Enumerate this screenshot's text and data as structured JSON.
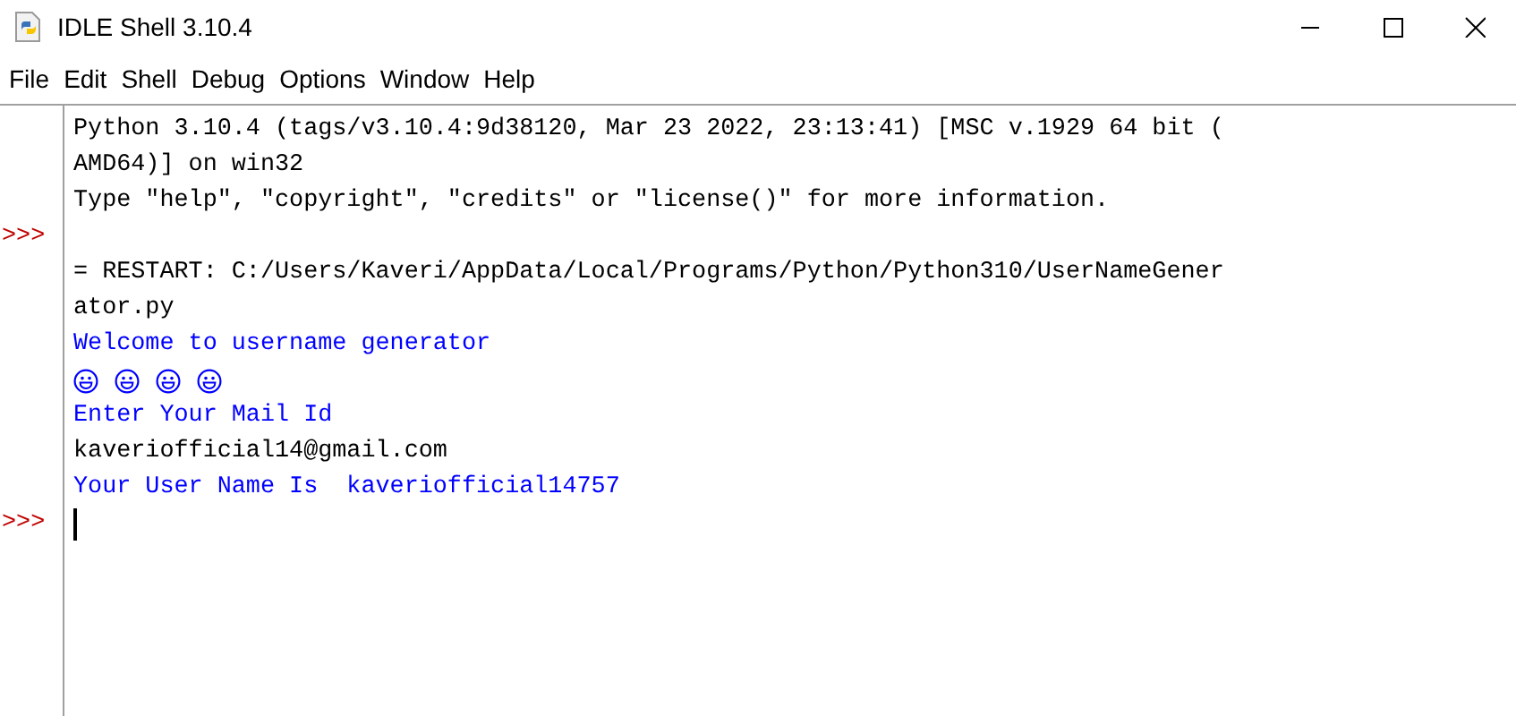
{
  "window": {
    "title": "IDLE Shell 3.10.4"
  },
  "menu": [
    "File",
    "Edit",
    "Shell",
    "Debug",
    "Options",
    "Window",
    "Help"
  ],
  "shell": {
    "lines": [
      {
        "kind": "output",
        "text": "Python 3.10.4 (tags/v3.10.4:9d38120, Mar 23 2022, 23:13:41) [MSC v.1929 64 bit ("
      },
      {
        "kind": "output",
        "text": "AMD64)] on win32"
      },
      {
        "kind": "output",
        "text": "Type \"help\", \"copyright\", \"credits\" or \"license()\" for more information."
      },
      {
        "kind": "blank",
        "prompt": ">>>"
      },
      {
        "kind": "output",
        "text": "= RESTART: C:/Users/Kaveri/AppData/Local/Programs/Python/Python310/UserNameGener"
      },
      {
        "kind": "output",
        "text": "ator.py"
      },
      {
        "kind": "stdout",
        "text": "Welcome to username generator"
      },
      {
        "kind": "icons",
        "icons": [
          {
            "kind": "smiley"
          },
          {
            "kind": "smiley"
          },
          {
            "kind": "smiley"
          },
          {
            "kind": "smiley"
          }
        ]
      },
      {
        "kind": "stdout",
        "text": "Enter Your Mail Id"
      },
      {
        "kind": "input",
        "text": "kaveriofficial14@gmail.com"
      },
      {
        "kind": "stdout",
        "text": "Your User Name Is  kaveriofficial14757"
      },
      {
        "kind": "cursor",
        "prompt": ">>>"
      }
    ]
  }
}
